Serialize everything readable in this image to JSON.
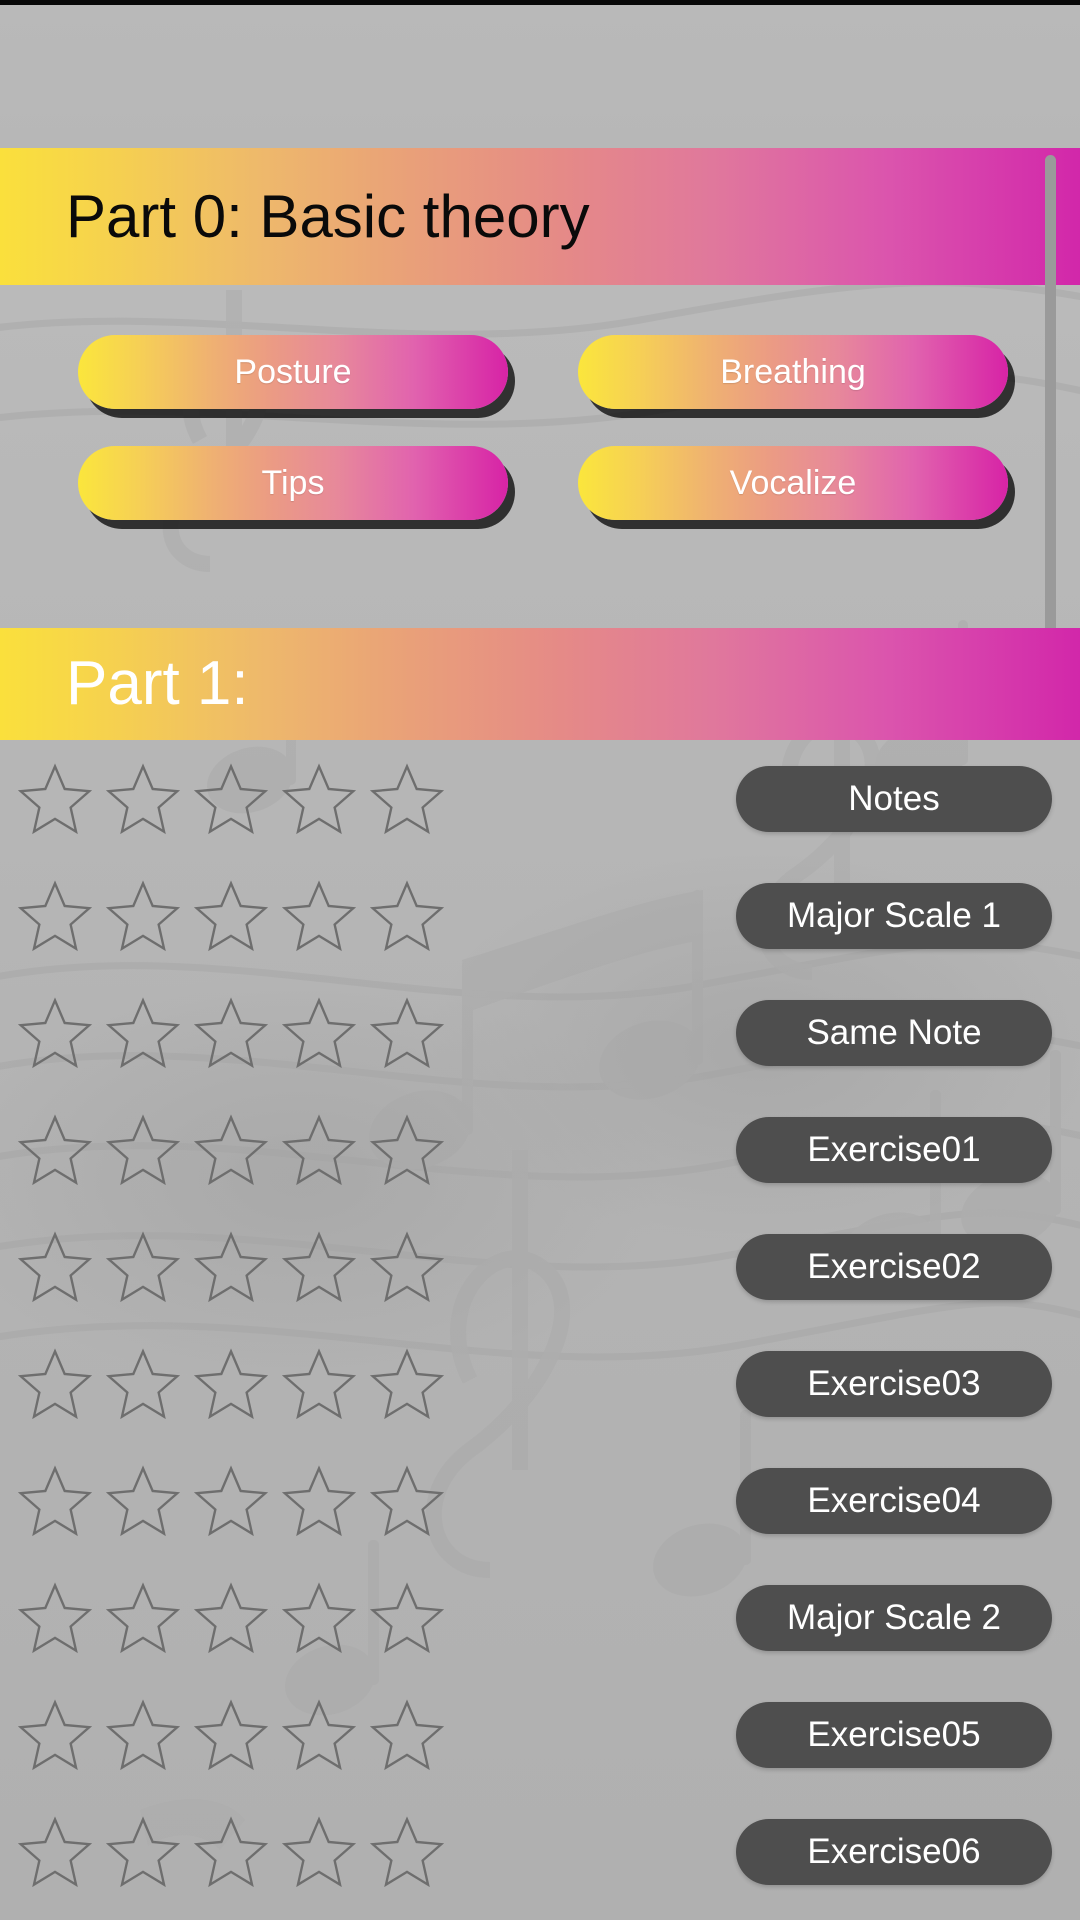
{
  "app": {
    "background_color": "#b6b6b6",
    "watermark_icon": "musical-notes-watermark"
  },
  "gradient": {
    "start": "#fae03c",
    "mid": "#e58a87",
    "end": "#d227aa"
  },
  "colors": {
    "accent_yellow": "#fae03c",
    "accent_magenta": "#d227aa",
    "pill_dark": "#4e4e4e",
    "star_outline": "#6e6e6e",
    "header0_text": "#0a0a0a",
    "header1_text": "#ffffff"
  },
  "part0": {
    "title": "Part 0: Basic theory",
    "buttons": [
      {
        "label": "Posture"
      },
      {
        "label": "Breathing"
      },
      {
        "label": "Tips"
      },
      {
        "label": "Vocalize"
      }
    ],
    "scrollbar": {
      "name": "vertical-scrollbar"
    }
  },
  "part1": {
    "title": "Part 1:",
    "star_count": 5,
    "stars_filled": 0,
    "items": [
      {
        "label": "Notes",
        "stars": 0
      },
      {
        "label": "Major Scale 1",
        "stars": 0
      },
      {
        "label": "Same Note",
        "stars": 0
      },
      {
        "label": "Exercise01",
        "stars": 0
      },
      {
        "label": "Exercise02",
        "stars": 0
      },
      {
        "label": "Exercise03",
        "stars": 0
      },
      {
        "label": "Exercise04",
        "stars": 0
      },
      {
        "label": "Major Scale 2",
        "stars": 0
      },
      {
        "label": "Exercise05",
        "stars": 0
      },
      {
        "label": "Exercise06",
        "stars": 0
      }
    ]
  }
}
